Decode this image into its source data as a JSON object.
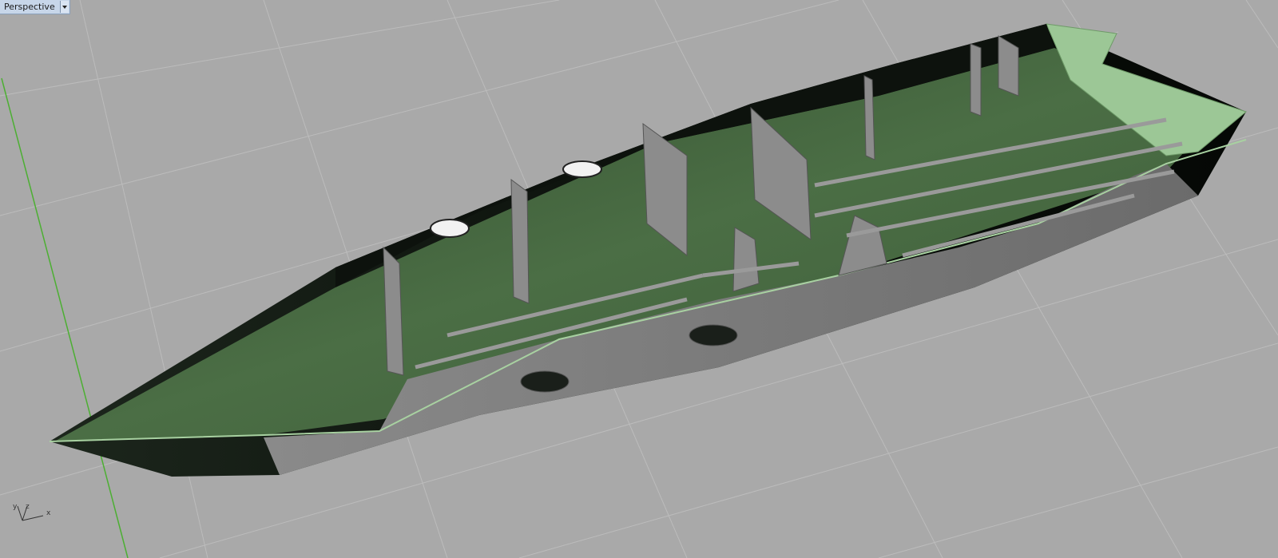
{
  "viewport": {
    "name": "Perspective",
    "background_color": "#a9a9a9",
    "grid_color": "#bcbcbc",
    "y_axis_color": "#4caf32"
  },
  "axis_widget": {
    "x_label": "x",
    "y_label": "y",
    "z_label": "z"
  },
  "model": {
    "hull_dark_color": "#0e140e",
    "hull_side_color": "#7a7a7a",
    "interior_color": "#3f5f3a",
    "deck_edge_color": "#9fc79a",
    "frame_color": "#8a8a8a"
  },
  "icons": {
    "viewport_menu": "chevron-down-icon"
  }
}
